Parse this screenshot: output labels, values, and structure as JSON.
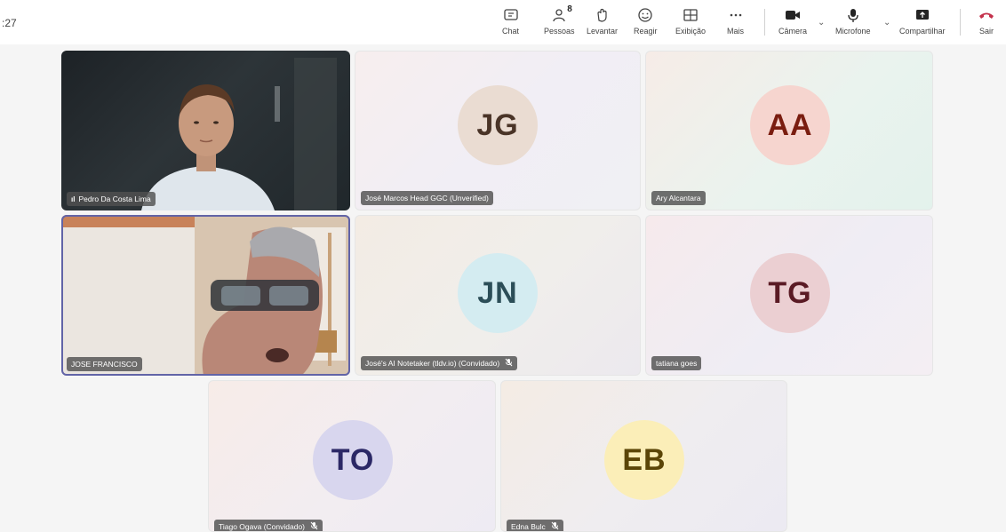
{
  "meeting": {
    "timer": ":27"
  },
  "toolbar": {
    "chat": "Chat",
    "people": "Pessoas",
    "people_count": "8",
    "raise": "Levantar",
    "react": "Reagir",
    "view": "Exibição",
    "more": "Mais",
    "camera": "Câmera",
    "mic": "Microfone",
    "share": "Compartilhar",
    "leave": "Sair"
  },
  "colors": {
    "accent": "#6264a7",
    "leave": "#c4314b"
  },
  "participants": [
    {
      "name": "Pedro Da Costa Lima",
      "type": "video",
      "signal": "ıl"
    },
    {
      "name": "José Marcos Head GGC (Unverified)",
      "initials": "JG",
      "avatar_bg": "#eadcd2",
      "avatar_fg": "#4a3427",
      "muted": false
    },
    {
      "name": "Ary Alcantara",
      "initials": "AA",
      "avatar_bg": "#f6d5cf",
      "avatar_fg": "#7a1d10",
      "muted": false
    },
    {
      "name": "JOSE FRANCISCO",
      "type": "video",
      "selected": true
    },
    {
      "name": "José's AI Notetaker (tldv.io) (Convidado)",
      "initials": "JN",
      "avatar_bg": "#d4ecf1",
      "avatar_fg": "#2c4e58",
      "muted": true
    },
    {
      "name": "tatiana goes",
      "initials": "TG",
      "avatar_bg": "#ebcfd2",
      "avatar_fg": "#5a1a24",
      "muted": false
    },
    {
      "name": "Tiago Ogava (Convidado)",
      "initials": "TO",
      "avatar_bg": "#d8d6ee",
      "avatar_fg": "#2b2866",
      "muted": true
    },
    {
      "name": "Edna Bulc",
      "initials": "EB",
      "avatar_bg": "#fbeeb8",
      "avatar_fg": "#5b4507",
      "muted": true
    }
  ]
}
